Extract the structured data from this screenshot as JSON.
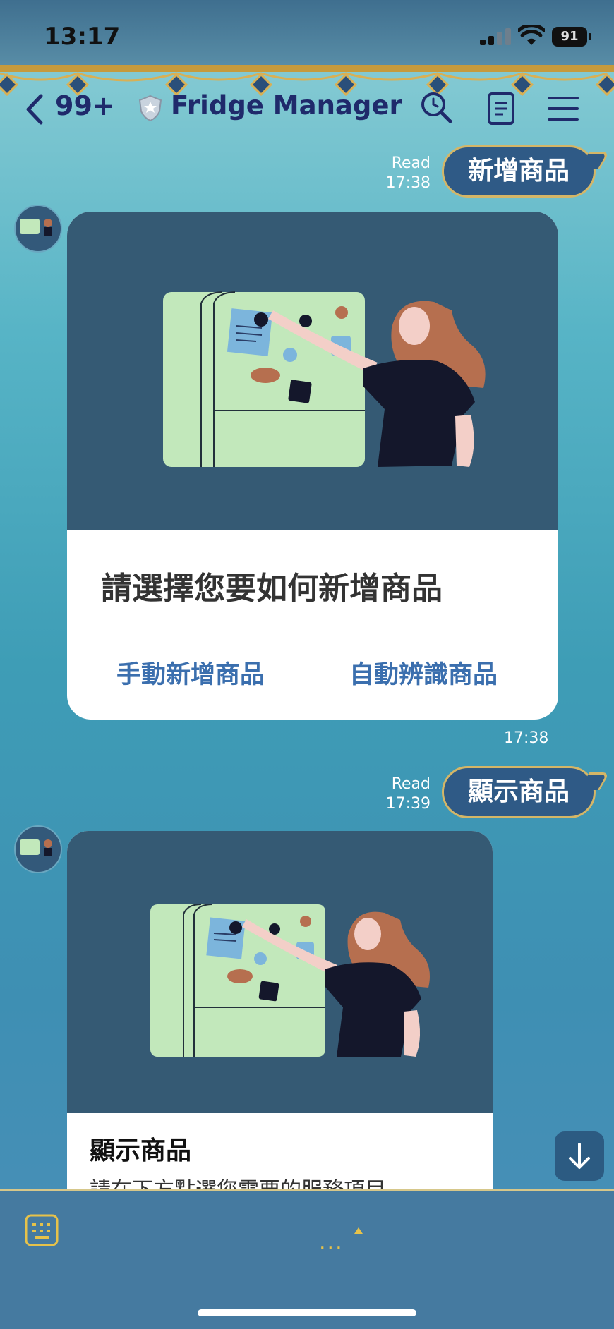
{
  "status_bar": {
    "time": "13:17",
    "battery": "91"
  },
  "header": {
    "back_label": "99+",
    "title": "Fridge Manager"
  },
  "messages": {
    "user_msg_1": {
      "read": "Read",
      "time": "17:38",
      "text": "新增商品"
    },
    "bot_card_1": {
      "title": "請選擇您要如何新增商品",
      "actions": [
        "手動新增商品",
        "自動辨識商品"
      ],
      "time": "17:38"
    },
    "user_msg_2": {
      "read": "Read",
      "time": "17:39",
      "text": "顯示商品"
    },
    "bot_card_2": {
      "title": "顯示商品",
      "subtitle": "請在下方點選您需要的服務項目"
    }
  },
  "bottom_bar": {
    "more": "..."
  },
  "colors": {
    "accent": "#2f5a86",
    "gold": "#d4b667",
    "card_image_bg": "#355a74",
    "fridge": "#c2e8bb",
    "link": "#3b6fae"
  },
  "icons": [
    "back-icon",
    "shield-icon",
    "search-icon",
    "notes-icon",
    "menu-icon",
    "keyboard-icon",
    "arrow-down-icon",
    "caret-up-icon"
  ]
}
